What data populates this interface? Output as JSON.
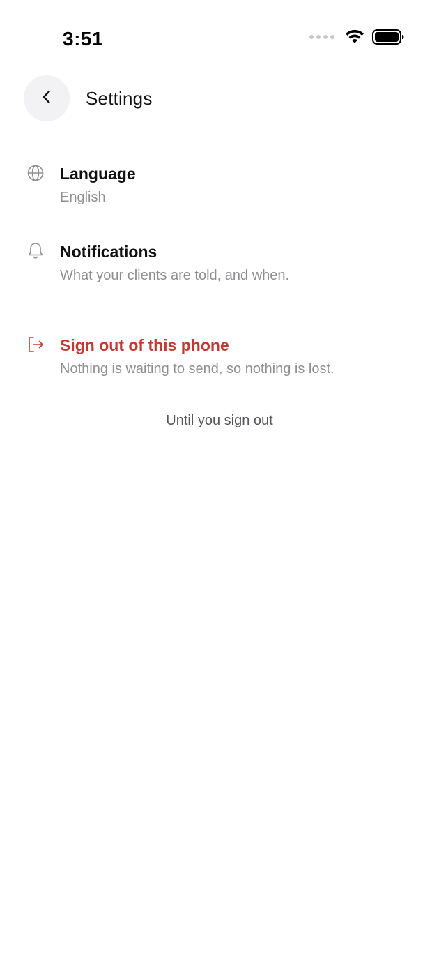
{
  "status_bar": {
    "time": "3:51"
  },
  "header": {
    "title": "Settings"
  },
  "settings": {
    "language": {
      "title": "Language",
      "value": "English",
      "icon": "globe-icon"
    },
    "notifications": {
      "title": "Notifications",
      "subtitle": "What your clients are told, and when.",
      "icon": "bell-icon"
    },
    "sign_out": {
      "title": "Sign out of this phone",
      "subtitle": "Nothing is waiting to send, so nothing is lost.",
      "icon": "sign-out-icon",
      "color": "#c13a32"
    }
  },
  "footer": {
    "note": "Until you sign out"
  },
  "colors": {
    "danger": "#c13a32",
    "secondary_text": "#8e8e93",
    "back_button_bg": "#f2f2f4"
  }
}
